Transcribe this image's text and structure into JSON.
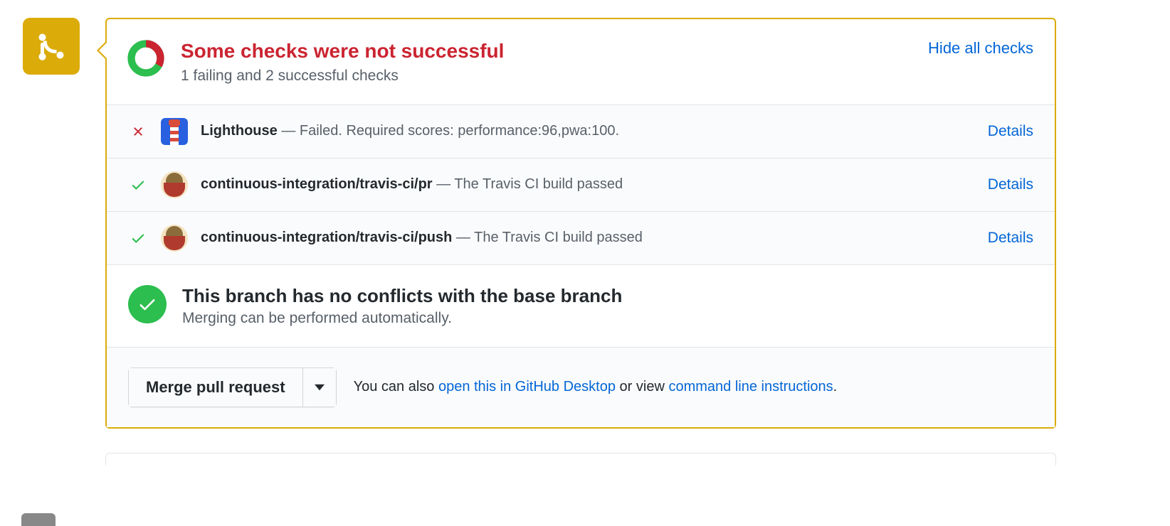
{
  "header": {
    "title": "Some checks were not successful",
    "subtitle": "1 failing and 2 successful checks",
    "toggle": "Hide all checks"
  },
  "checks": [
    {
      "status": "fail",
      "avatar": "lighthouse",
      "name": "Lighthouse",
      "message": "Failed. Required scores: performance:96,pwa:100.",
      "action": "Details"
    },
    {
      "status": "pass",
      "avatar": "travis",
      "name": "continuous-integration/travis-ci/pr",
      "message": "The Travis CI build passed",
      "action": "Details"
    },
    {
      "status": "pass",
      "avatar": "travis",
      "name": "continuous-integration/travis-ci/push",
      "message": "The Travis CI build passed",
      "action": "Details"
    }
  ],
  "conflict": {
    "title": "This branch has no conflicts with the base branch",
    "subtitle": "Merging can be performed automatically."
  },
  "merge": {
    "button": "Merge pull request",
    "hint_prefix": "You can also ",
    "link1": "open this in GitHub Desktop",
    "hint_mid": " or view ",
    "link2": "command line instructions",
    "hint_suffix": "."
  },
  "colors": {
    "danger": "#cb2431",
    "link": "#0366d6",
    "success": "#2cbe4e",
    "pending": "#dbab09"
  }
}
